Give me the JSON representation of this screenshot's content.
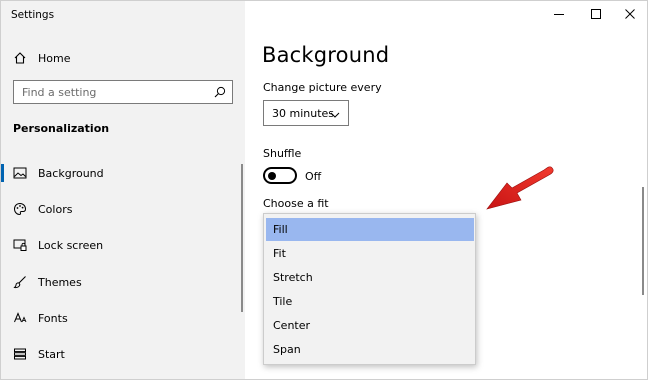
{
  "window": {
    "title": "Settings"
  },
  "titlebar": {
    "minimize_icon": "minimize-icon",
    "maximize_icon": "maximize-icon",
    "close_icon": "close-icon"
  },
  "sidebar": {
    "home": {
      "label": "Home",
      "icon": "home-icon"
    },
    "search": {
      "placeholder": "Find a setting",
      "icon": "search-icon"
    },
    "section_title": "Personalization",
    "items": [
      {
        "label": "Background",
        "icon": "picture-icon",
        "active": true
      },
      {
        "label": "Colors",
        "icon": "palette-icon",
        "active": false
      },
      {
        "label": "Lock screen",
        "icon": "lock-screen-icon",
        "active": false
      },
      {
        "label": "Themes",
        "icon": "brush-icon",
        "active": false
      },
      {
        "label": "Fonts",
        "icon": "font-icon",
        "active": false
      },
      {
        "label": "Start",
        "icon": "start-icon",
        "active": false
      }
    ]
  },
  "main": {
    "title": "Background",
    "change_picture": {
      "label": "Change picture every",
      "value": "30 minutes"
    },
    "shuffle": {
      "label": "Shuffle",
      "state": "Off"
    },
    "fit": {
      "label": "Choose a fit",
      "selected": "Fill",
      "options": [
        "Fill",
        "Fit",
        "Stretch",
        "Tile",
        "Center",
        "Span"
      ]
    }
  },
  "annotation": {
    "arrow_color": "#e8231f"
  },
  "colors": {
    "accent": "#0063b1",
    "selection": "#99b7ef",
    "sidebar_bg": "#f2f2f2"
  }
}
